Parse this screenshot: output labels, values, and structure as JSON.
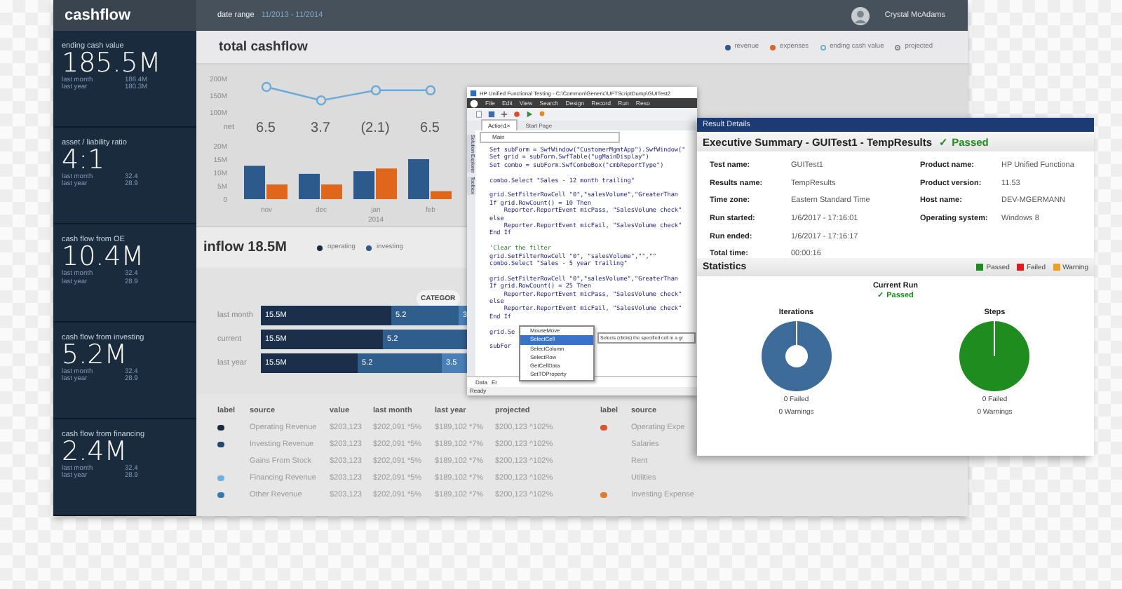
{
  "header": {
    "brand": "cashflow",
    "date_label": "date range",
    "date_value": "11/2013 - 11/2014",
    "user": "Crystal McAdams"
  },
  "sidebar": {
    "cards": [
      {
        "label": "ending cash value",
        "value": "185.5M",
        "rows": [
          {
            "label": "last month",
            "value": "186.4M"
          },
          {
            "label": "last year",
            "value": "180.3M"
          }
        ]
      },
      {
        "label": "asset / liability ratio",
        "value": "4:1",
        "rows": [
          {
            "label": "last month",
            "value": "32.4"
          },
          {
            "label": "last year",
            "value": "28.9"
          }
        ]
      },
      {
        "label": "cash flow from OE",
        "value": "10.4M",
        "rows": [
          {
            "label": "last month",
            "value": "32.4"
          },
          {
            "label": "last year",
            "value": "28.9"
          }
        ]
      },
      {
        "label": "cash flow from investing",
        "value": "5.2M",
        "rows": [
          {
            "label": "last month",
            "value": "32.4"
          },
          {
            "label": "last year",
            "value": "28.9"
          }
        ]
      },
      {
        "label": "cash flow from financing",
        "value": "2.4M",
        "rows": [
          {
            "label": "last month",
            "value": "32.4"
          },
          {
            "label": "last year",
            "value": "28.9"
          }
        ]
      }
    ]
  },
  "cashflow": {
    "title": "total cashflow",
    "legend": [
      {
        "label": "projected",
        "kind": "target",
        "color": "#8a8a8a"
      }
    ],
    "line_chart": {
      "chart_data": {
        "type": "line",
        "series": [
          {
            "name": "ending cash value",
            "color": "#6aaad8",
            "marker": true,
            "values": [
              175,
              135,
              165,
              165
            ]
          }
        ],
        "ylim": [
          100,
          200
        ],
        "yticks": [
          {
            "value": 200,
            "label": "200M"
          },
          {
            "value": 150,
            "label": "150M"
          },
          {
            "value": 100,
            "label": "100M"
          }
        ]
      }
    },
    "net": {
      "label": "net",
      "values": [
        "6.5",
        "3.7",
        "(2.1)",
        "6.5"
      ]
    },
    "bar_chart": {
      "year_label": "2014",
      "chart_data": {
        "type": "bar",
        "categories": [
          "nov",
          "dec",
          "jan",
          "feb"
        ],
        "series": [
          {
            "name": "revenue",
            "color": "#2c5a8c",
            "values": [
              12.5,
              9.5,
              10.5,
              15
            ]
          },
          {
            "name": "expenses",
            "color": "#e0661c",
            "values": [
              5.5,
              5.5,
              11.5,
              3
            ]
          }
        ],
        "ylim": [
          0,
          20
        ],
        "yticks": [
          {
            "value": 20,
            "label": "20M"
          },
          {
            "value": 15,
            "label": "15M"
          },
          {
            "value": 10,
            "label": "10M"
          },
          {
            "value": 5,
            "label": "5M"
          },
          {
            "value": 0,
            "label": "0"
          }
        ]
      }
    }
  },
  "inflow": {
    "title": "inflow 18.5M",
    "legend": [
      {
        "label": "operating",
        "color": "#1a2a40"
      },
      {
        "label": "investing",
        "color": "#2c5a8c"
      }
    ],
    "category_button": "CATEGOR",
    "rows": [
      {
        "label": "last month",
        "segments": [
          "15.5M",
          "5.2",
          "3."
        ]
      },
      {
        "label": "current",
        "segments": [
          "15.5M",
          "5.2"
        ]
      },
      {
        "label": "last year",
        "segments": [
          "15.5M",
          "5.2",
          "3.5"
        ]
      }
    ]
  },
  "table": {
    "columns": [
      "label",
      "source",
      "value",
      "last month",
      "last year",
      "projected"
    ],
    "rows": [
      {
        "color": "#1a2a40",
        "cells": [
          "",
          "Operating Revenue",
          "$203,123",
          "$202,091 *5%",
          "$189,102 *7%",
          "$200,123 ^102%"
        ]
      },
      {
        "color": "#23466e",
        "cells": [
          "",
          "Investing Revenue",
          "$203,123",
          "$202,091 *5%",
          "$189,102 *7%",
          "$200,123 ^102%"
        ]
      },
      {
        "cells": [
          "",
          "Gains From Stock",
          "$203,123",
          "$202,091 *5%",
          "$189,102 *7%",
          "$200,123 ^102%"
        ]
      },
      {
        "color": "#6fb0e0",
        "cells": [
          "",
          "Financing Revenue",
          "$203,123",
          "$202,091 *5%",
          "$189,102 *7%",
          "$200,123 ^102%"
        ]
      },
      {
        "color": "#3a78b0",
        "cells": [
          "",
          "Other Revenue",
          "$203,123",
          "$202,091 *5%",
          "$189,102 *7%",
          "$200,123 ^102%"
        ]
      }
    ]
  },
  "table_2": {
    "columns": [
      "label",
      "source"
    ],
    "rows": [
      {
        "color": "#d9532c",
        "cells": [
          "",
          "Operating Expe"
        ]
      },
      {
        "cells": [
          "",
          "Salaries"
        ]
      },
      {
        "cells": [
          "",
          "Rent"
        ]
      },
      {
        "cells": [
          "",
          "Utilities"
        ]
      },
      {
        "color": "#e07a2c",
        "cells": [
          "",
          "Investing Expense"
        ]
      }
    ]
  },
  "uft_window": {
    "title": "HP Unified Functional Testing - C:\\Common\\Generic\\UFTScriptDump\\GUITest2",
    "menu": [
      "File",
      "Edit",
      "View",
      "Search",
      "Design",
      "Record",
      "Run",
      "Reso"
    ],
    "side_tabs": [
      "Solution Explorer",
      "Toolbox"
    ],
    "tabs": [
      {
        "label": "Action1",
        "close": "×",
        "selected": true
      },
      {
        "label": "Start Page",
        "selected": false
      }
    ],
    "dropdown": "Main",
    "blocks": [
      {
        "lines": [
          {
            "kind": "code",
            "text": "Set subForm = SwfWindow(\"CustomerMgmtApp\").SwfWindow(\""
          },
          {
            "kind": "code",
            "text": "Set grid = subForm.SwfTable(\"ugMainDisplay\")"
          },
          {
            "kind": "code",
            "text": "Set combo = subForm.SwfComboBox(\"cmbReportType\")"
          }
        ]
      },
      {
        "lines": [
          {
            "kind": "code",
            "text": "combo.Select \"Sales - 12 month trailing\""
          }
        ]
      },
      {
        "lines": [
          {
            "kind": "code",
            "text": "grid.SetFilterRowCell \"0\",\"salesVolume\",\"GreaterThan"
          },
          {
            "kind": "code",
            "text": "If grid.RowCount() = 10 Then"
          },
          {
            "kind": "code",
            "text": "    Reporter.ReportEvent micPass, \"SalesVolume check\""
          },
          {
            "kind": "code",
            "text": "else"
          },
          {
            "kind": "code",
            "text": "    Reporter.ReportEvent micFail, \"SalesVolume check\""
          },
          {
            "kind": "code",
            "text": "End If"
          }
        ]
      },
      {
        "lines": [
          {
            "kind": "comment",
            "text": "'Clear the filter"
          },
          {
            "kind": "code",
            "text": "grid.SetFilterRowCell \"0\", \"salesVolume\",\"\",\"\""
          },
          {
            "kind": "code",
            "text": "combo.Select \"Sales - 5 year trailing\""
          }
        ]
      },
      {
        "lines": [
          {
            "kind": "code",
            "text": "grid.SetFilterRowCell \"0\",\"salesVolume\",\"GreaterThan"
          },
          {
            "kind": "code",
            "text": "If grid.RowCount() = 25 Then"
          },
          {
            "kind": "code",
            "text": "    Reporter.ReportEvent micPass, \"SalesVolume check\""
          },
          {
            "kind": "code",
            "text": "else"
          },
          {
            "kind": "code",
            "text": "    Reporter.ReportEvent micFail, \"SalesVolume check\""
          },
          {
            "kind": "code",
            "text": "End If"
          }
        ]
      },
      {
        "lines": [
          {
            "kind": "code",
            "text": "grid.Se"
          }
        ]
      },
      {
        "lines": [
          {
            "kind": "code",
            "text": "subFor"
          }
        ]
      }
    ],
    "autocomplete": {
      "items": [
        {
          "label": "MouseMove",
          "selected": false
        },
        {
          "label": "SelectCell",
          "selected": true
        },
        {
          "label": "SelectColumn",
          "selected": false
        },
        {
          "label": "SelectRow",
          "selected": false
        },
        {
          "label": "GetCellData",
          "selected": false
        },
        {
          "label": "SetTOProperty",
          "selected": false
        }
      ],
      "tooltip": "Selects (clicks) the specified cell in a gr"
    },
    "bottom_tabs": [
      "Data",
      "Er"
    ],
    "status": "Ready"
  },
  "result_window": {
    "header": "Result Details",
    "title": "Executive Summary - GUITest1 - TempResults",
    "status": {
      "mark": "✓",
      "label": "Passed"
    },
    "fields_left": [
      {
        "label": "Test name:",
        "value": "GUITest1"
      },
      {
        "label": "Results name:",
        "value": "TempResults"
      },
      {
        "label": "Time zone:",
        "value": "Eastern Standard Time"
      },
      {
        "label": "Run started:",
        "value": "1/6/2017 - 17:16:01"
      },
      {
        "label": "Run ended:",
        "value": "1/6/2017 - 17:16:17"
      },
      {
        "label": "Total time:",
        "value": "00:00:16"
      }
    ],
    "fields_right": [
      {
        "label": "Product name:",
        "value": "HP Unified Functiona"
      },
      {
        "label": "Product version:",
        "value": "11.53"
      },
      {
        "label": "Host name:",
        "value": "DEV-MGERMANN"
      },
      {
        "label": "Operating system:",
        "value": "Windows 8"
      }
    ],
    "statistics": {
      "title": "Statistics",
      "legend": [
        {
          "label": "Passed",
          "color": "#1f8a1f"
        },
        {
          "label": "Failed",
          "color": "#d81e1e"
        },
        {
          "label": "Warning",
          "color": "#f0a020"
        }
      ]
    },
    "current_run": {
      "title": "Current Run",
      "mark": "✓",
      "label": "Passed"
    },
    "panels": [
      {
        "kind": "donut",
        "title": "Iterations",
        "color": "#3d6b9a",
        "failed": "0 Failed",
        "warnings": "0 Warnings"
      },
      {
        "kind": "pie",
        "title": "Steps",
        "color": "#1e8c1e",
        "failed": "0 Failed",
        "warnings": "0 Warnings"
      }
    ]
  }
}
